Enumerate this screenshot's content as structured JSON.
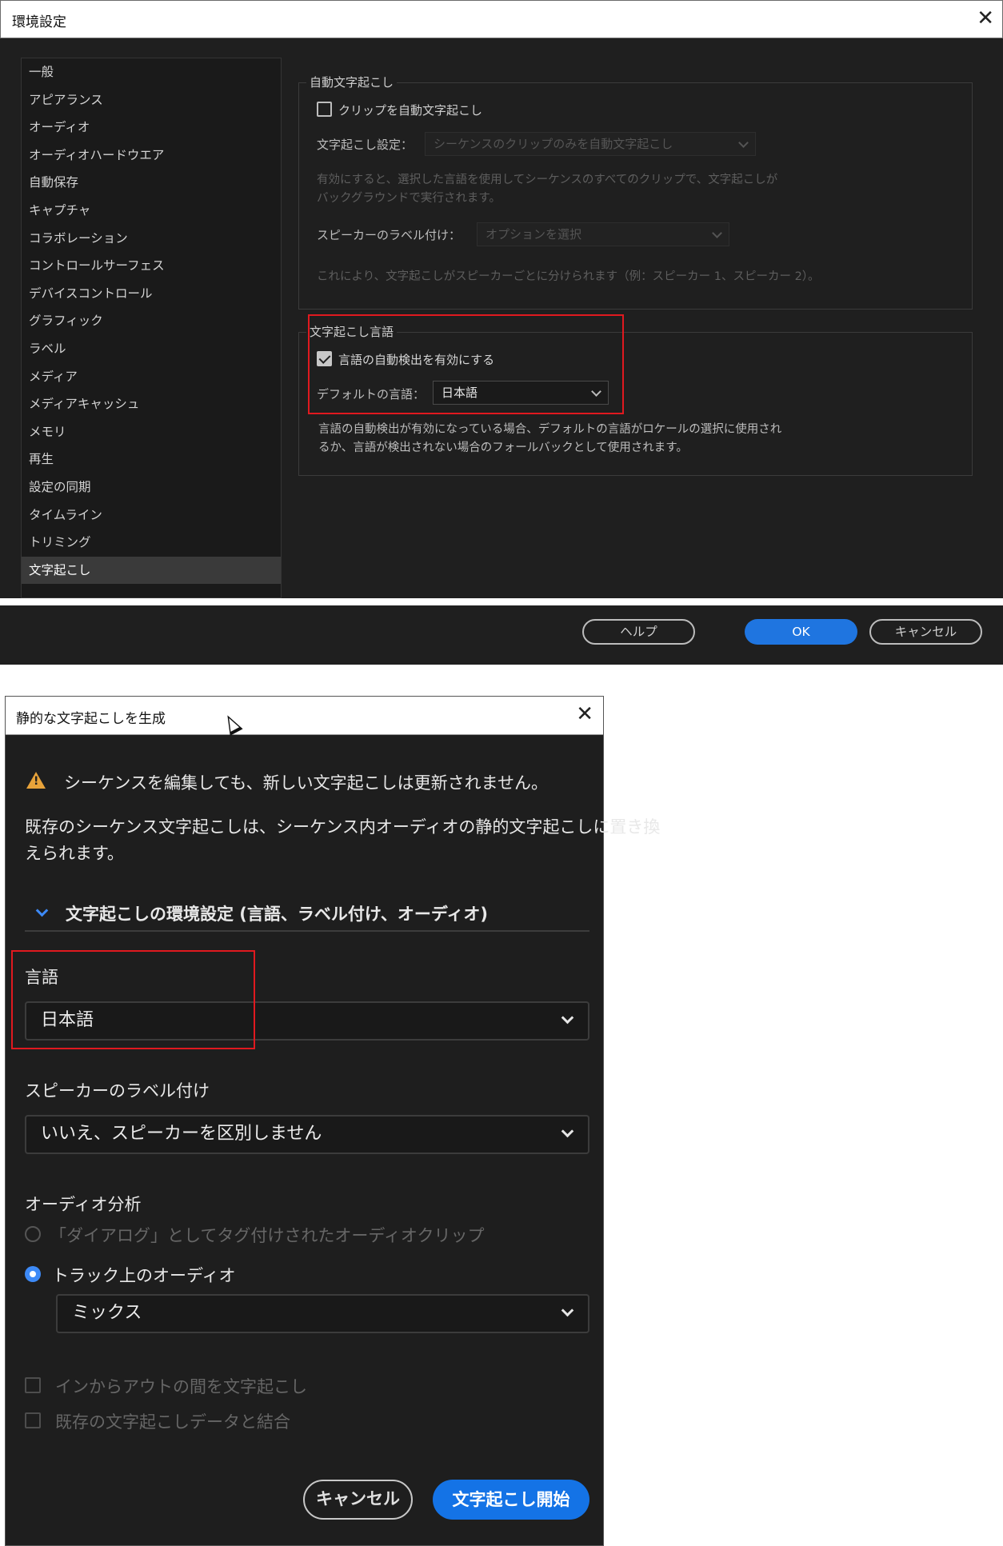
{
  "preferences": {
    "title": "環境設定",
    "close": "✕",
    "sidebar": [
      {
        "label": "一般"
      },
      {
        "label": "アピアランス"
      },
      {
        "label": "オーディオ"
      },
      {
        "label": "オーディオハードウエア"
      },
      {
        "label": "自動保存"
      },
      {
        "label": "キャプチャ"
      },
      {
        "label": "コラボレーション"
      },
      {
        "label": "コントロールサーフェス"
      },
      {
        "label": "デバイスコントロール"
      },
      {
        "label": "グラフィック"
      },
      {
        "label": "ラベル"
      },
      {
        "label": "メディア"
      },
      {
        "label": "メディアキャッシュ"
      },
      {
        "label": "メモリ"
      },
      {
        "label": "再生"
      },
      {
        "label": "設定の同期"
      },
      {
        "label": "タイムライン"
      },
      {
        "label": "トリミング"
      },
      {
        "label": "文字起こし",
        "selected": true
      }
    ],
    "auto_transcribe": {
      "legend": "自動文字起こし",
      "checkbox_label": "クリップを自動文字起こし",
      "settings_label": "文字起こし設定：",
      "settings_value": "シーケンスのクリップのみを自動文字起こし",
      "description_line1": "有効にすると、選択した言語を使用してシーケンスのすべてのクリップで、文字起こしが",
      "description_line2": "バックグラウンドで実行されます。",
      "speaker_label": "スピーカーのラベル付け：",
      "speaker_value": "オプションを選択",
      "speaker_note": "これにより、文字起こしがスピーカーごとに分けられます（例：スピーカー 1、スピーカー 2）。"
    },
    "language": {
      "legend": "文字起こし言語",
      "auto_detect_label": "言語の自動検出を有効にする",
      "auto_detect_checked": true,
      "default_label": "デフォルトの言語：",
      "default_value": "日本語",
      "note_line1": "言語の自動検出が有効になっている場合、デフォルトの言語がロケールの選択に使用され",
      "note_line2": "るか、言語が検出されない場合のフォールバックとして使用されます。"
    },
    "buttons": {
      "help": "ヘルプ",
      "ok": "OK",
      "cancel": "キャンセル"
    }
  },
  "static_transcript_dialog": {
    "title": "静的な文字起こしを生成",
    "close": "✕",
    "warning": "シーケンスを編集しても、新しい文字起こしは更新されません。",
    "info_line1": "既存のシーケンス文字起こしは、シーケンス内オーディオの静的文字起こしに置き換",
    "info_line2": "えられます。",
    "section_title": "文字起こしの環境設定 (言語、ラベル付け、オーディオ)",
    "language_label": "言語",
    "language_value": "日本語",
    "speaker_label": "スピーカーのラベル付け",
    "speaker_value": "いいえ、スピーカーを区別しません",
    "audio_label": "オーディオ分析",
    "radio_dialog": "「ダイアログ」としてタグ付けされたオーディオクリップ",
    "radio_track": "トラック上のオーディオ",
    "track_value": "ミックス",
    "checkbox_inout": "インからアウトの間を文字起こし",
    "checkbox_merge": "既存の文字起こしデータと結合",
    "cancel": "キャンセル",
    "start": "文字起こし開始"
  },
  "colors": {
    "highlight": "#e0191f",
    "primary": "#1473e6",
    "warning": "#e8a33a"
  }
}
